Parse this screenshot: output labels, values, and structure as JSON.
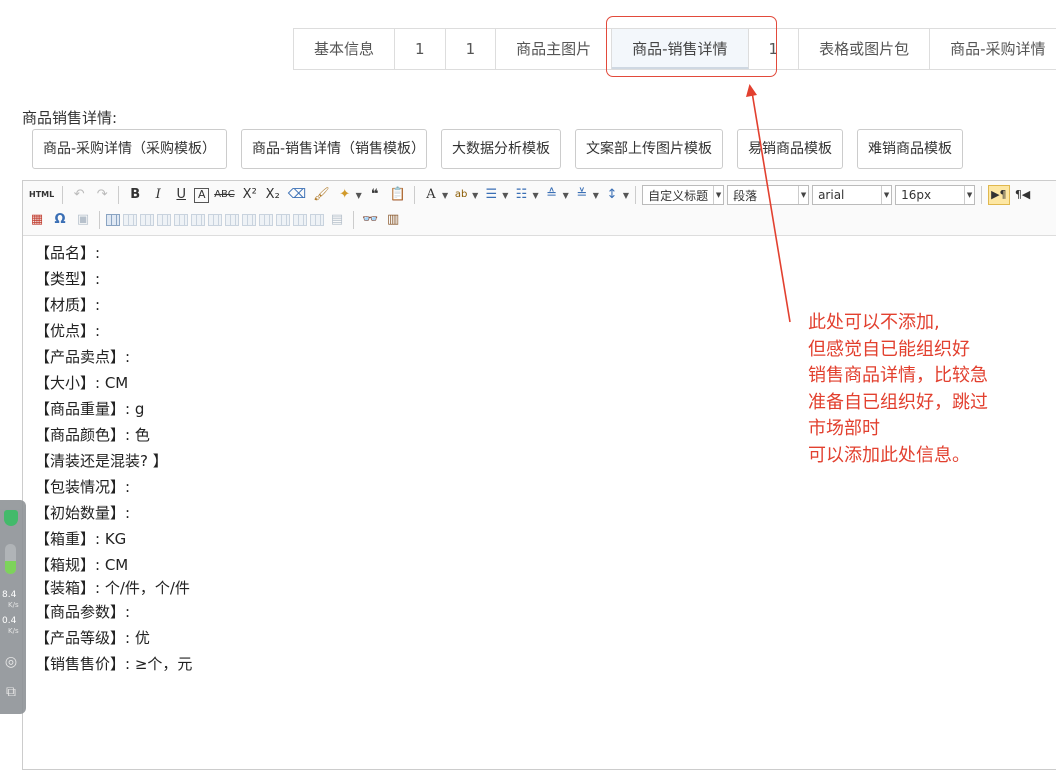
{
  "tabs": [
    {
      "label": "基本信息",
      "active": false
    },
    {
      "label": "1",
      "active": false
    },
    {
      "label": "1",
      "active": false
    },
    {
      "label": "商品主图片",
      "active": false
    },
    {
      "label": "商品-销售详情",
      "active": true
    },
    {
      "label": "1",
      "active": false
    },
    {
      "label": "表格或图片包",
      "active": false
    },
    {
      "label": "商品-采购详情",
      "active": false
    }
  ],
  "section_label": "商品销售详情:",
  "templates": [
    "商品-采购详情（采购模板）",
    "商品-销售详情（销售模板）",
    "大数据分析模板",
    "文案部上传图片模板",
    "易销商品模板",
    "难销商品模板"
  ],
  "toolbar": {
    "html_label": "HTML",
    "heading_select": "自定义标题",
    "paragraph_select": "段落",
    "font_select": "arial",
    "size_select": "16px"
  },
  "content_lines": [
    "【品名】:",
    "【类型】:",
    "【材质】:",
    "【优点】:",
    "【产品卖点】:",
    "【大小】: CM",
    "【商品重量】: g",
    "【商品颜色】: 色",
    "【清装还是混装? 】",
    "【包装情况】:",
    "【初始数量】:",
    "【箱重】: KG",
    "【箱规】: CM",
    "【装箱】: 个/件，个/件",
    "【商品参数】:",
    "【产品等级】: 优",
    "【销售售价】: ≥个，元"
  ],
  "annotation": [
    "此处可以不添加,",
    "但感觉自已能组织好",
    "销售商品详情，比较急",
    "准备自已组织好，跳过",
    "市场部时",
    "可以添加此处信息。"
  ],
  "widget": {
    "speed_up": "8.4",
    "speed_down": "0.4",
    "unit": "K/s",
    "level": 0.45
  },
  "colors": {
    "annotation": "#e2402f",
    "active_tab_bg": "#f3f7fb",
    "border": "#dddddd"
  }
}
